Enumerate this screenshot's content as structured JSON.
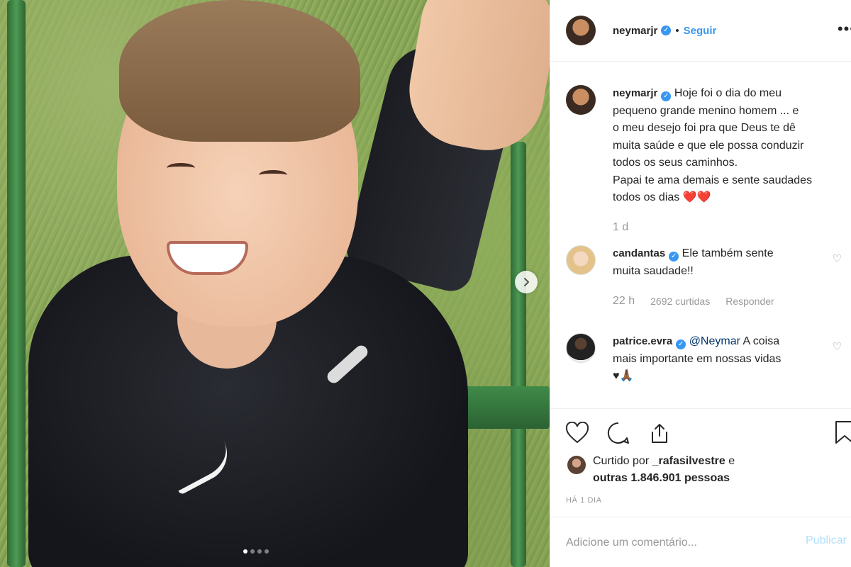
{
  "post": {
    "author": "neymarjr",
    "follow_label": "Seguir",
    "bullet": "•",
    "more_label": "•••",
    "caption_lines": [
      "Hoje foi o dia do meu",
      "pequeno grande menino homem ... e",
      "o meu desejo foi pra que Deus te dê",
      "muita saúde e que ele possa conduzir",
      "todos os seus caminhos.",
      "Papai te ama demais e sente saudades",
      "todos os dias ❤️❤️"
    ],
    "caption_time": "1 d"
  },
  "comments": [
    {
      "user": "candantas",
      "text_lines": [
        "Ele também sente",
        "muita saudade!!"
      ],
      "time": "22 h",
      "likes": "2692 curtidas",
      "reply": "Responder"
    },
    {
      "user": "patrice.evra",
      "mention": "@Neymar",
      "text_lines": [
        "A coisa",
        "mais importante em nossas vidas",
        "♥🙏🏾"
      ]
    }
  ],
  "likes": {
    "prefix": "Curtido por",
    "user": "_rafasilvestre",
    "conj": "e",
    "others": "outras 1.846.901 pessoas"
  },
  "posted_ago": "HÁ 1 DIA",
  "comment_box": {
    "placeholder": "Adicione um comentário...",
    "publish": "Publicar"
  },
  "carousel": {
    "count": 4,
    "active_index": 0
  },
  "colors": {
    "accent": "#3897f0",
    "muted": "#999999",
    "text": "#262626"
  }
}
